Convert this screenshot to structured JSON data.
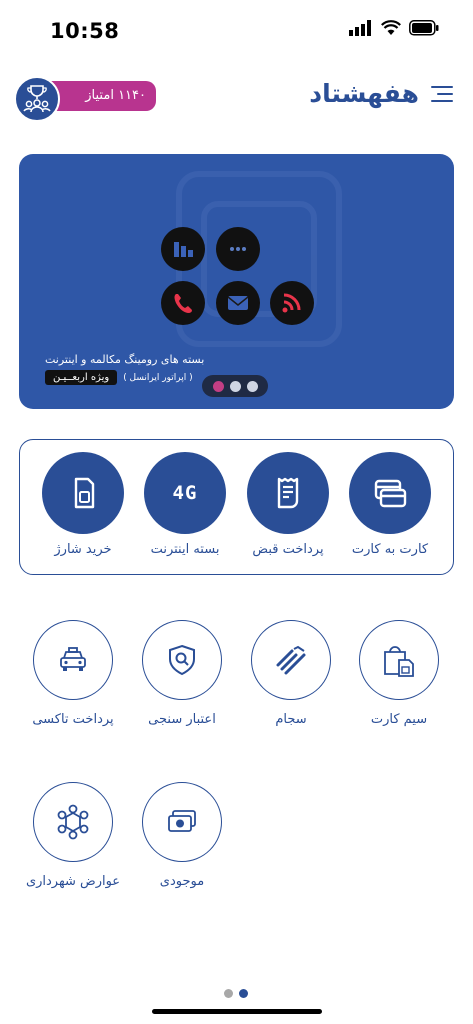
{
  "status_bar": {
    "time": "10:58"
  },
  "header": {
    "points_label": "۱۱۴۰ امتیاز",
    "app_name": "هفهشتاد"
  },
  "banner": {
    "title": "بسته های رومینگ مکالمه و اینترنت",
    "operator": "( اپراتور ایرانسل )",
    "badge": "ویژه اربعــیـن",
    "active_slide": 1,
    "slide_count": 3,
    "icon_colors": {
      "chart": "#3b62b8",
      "more": "#3b62b8",
      "phone": "#e8344a",
      "mail": "#3b62b8",
      "rss": "#e8344a"
    }
  },
  "primary_services": [
    {
      "id": "card-to-card",
      "label": "کارت به کارت",
      "icon": "cards-icon"
    },
    {
      "id": "bill-payment",
      "label": "پرداخت قبض",
      "icon": "receipt-icon"
    },
    {
      "id": "internet-package",
      "label": "بسته اینترنت",
      "icon": "4g-icon",
      "icon_text": "4G"
    },
    {
      "id": "buy-charge",
      "label": "خرید شارژ",
      "icon": "sim-icon"
    }
  ],
  "secondary_services": [
    {
      "id": "sim-card",
      "label": "سیم کارت",
      "icon": "sim-shop-icon"
    },
    {
      "id": "sajam",
      "label": "سجام",
      "icon": "sajam-logo-icon"
    },
    {
      "id": "credit-score",
      "label": "اعتبار سنجی",
      "icon": "shield-search-icon"
    },
    {
      "id": "taxi-payment",
      "label": "پرداخت تاکسی",
      "icon": "taxi-icon"
    },
    {
      "id": "balance",
      "label": "موجودی",
      "icon": "money-icon"
    },
    {
      "id": "municipal-fees",
      "label": "عوارض شهرداری",
      "icon": "municipal-icon"
    }
  ],
  "pager": {
    "current": 2,
    "total": 2
  },
  "colors": {
    "primary": "#2a4e96",
    "accent": "#b8348f",
    "banner_bg": "#2f57a7"
  }
}
